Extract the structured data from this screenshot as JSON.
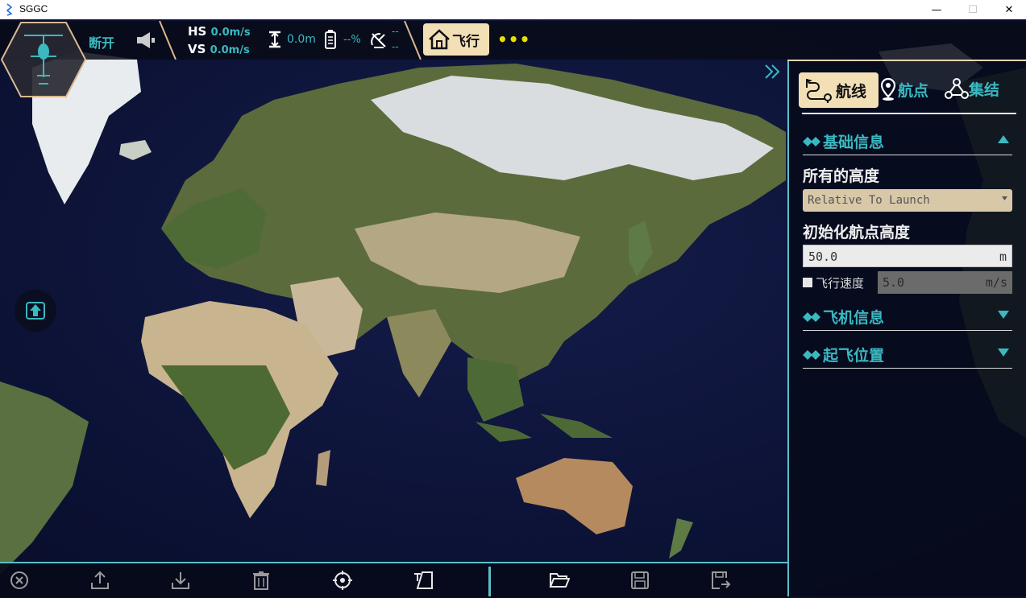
{
  "window": {
    "title": "SGGC",
    "minimize_glyph": "—",
    "maximize_glyph": "☐",
    "close_glyph": "✕"
  },
  "topbar": {
    "connection_status": "断开",
    "hs_label": "HS",
    "hs_value": "0.0m/s",
    "vs_label": "VS",
    "vs_value": "0.0m/s",
    "altitude_value": "0.0m",
    "battery_value": "--%",
    "satellite_value_1": "--",
    "satellite_value_2": "--",
    "fly_button_label": "飞行",
    "more_label": "•••",
    "icons": [
      "drone-icon",
      "speaker-icon",
      "altitude-icon",
      "battery-icon",
      "satellite-icon",
      "home-icon",
      "more-dots-icon"
    ]
  },
  "panel": {
    "tabs": [
      {
        "label": "航线",
        "icon": "route-icon",
        "active": true
      },
      {
        "label": "航点",
        "icon": "map-pin-icon",
        "active": false
      },
      {
        "label": "集结",
        "icon": "rally-icon",
        "active": false
      }
    ],
    "sections": {
      "basic_info": {
        "label": "基础信息",
        "expanded": true
      },
      "aircraft_info": {
        "label": "飞机信息",
        "expanded": false
      },
      "takeoff_position": {
        "label": "起飞位置",
        "expanded": false
      }
    },
    "all_altitude_label": "所有的高度",
    "altitude_mode_selected": "Relative To Launch",
    "init_waypoint_alt_label": "初始化航点高度",
    "init_waypoint_alt_value": "50.0",
    "init_waypoint_alt_unit": "m",
    "flight_speed_label": "飞行速度",
    "flight_speed_value": "5.0",
    "flight_speed_unit": "m/s",
    "flight_speed_checked": false
  },
  "toolbar": {
    "icons": [
      "clear-icon",
      "upload-icon",
      "download-icon",
      "delete-icon",
      "locate-icon",
      "edit-icon",
      "open-folder-icon",
      "save-icon",
      "save-as-icon"
    ]
  },
  "colors": {
    "accent": "#3bb8c0",
    "button_bg": "#f2dfb6",
    "dots": "#e6e000",
    "panel_bg": "#060a1a"
  }
}
